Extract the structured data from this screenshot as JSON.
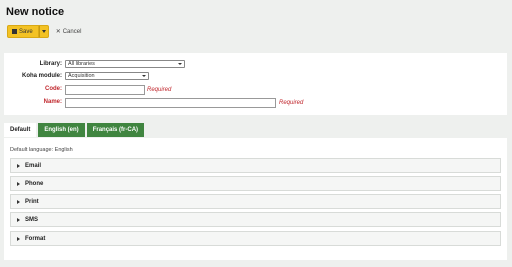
{
  "page": {
    "title": "New notice"
  },
  "toolbar": {
    "save_label": "Save",
    "cancel_label": "Cancel"
  },
  "form": {
    "library": {
      "label": "Library:",
      "value": "All libraries"
    },
    "module": {
      "label": "Koha module:",
      "value": "Acquisition"
    },
    "code": {
      "label": "Code:",
      "required_text": "Required",
      "value": ""
    },
    "name": {
      "label": "Name:",
      "required_text": "Required",
      "value": ""
    }
  },
  "tabs": [
    {
      "label": "Default",
      "active": true
    },
    {
      "label": "English (en)",
      "active": false
    },
    {
      "label": "Français (fr-CA)",
      "active": false
    }
  ],
  "panel": {
    "default_language": "Default language: English",
    "sections": [
      "Email",
      "Phone",
      "Print",
      "SMS",
      "Format"
    ]
  },
  "colors": {
    "save_button": "#f3c224",
    "tab_green": "#408540",
    "required_red": "#c0272d"
  }
}
